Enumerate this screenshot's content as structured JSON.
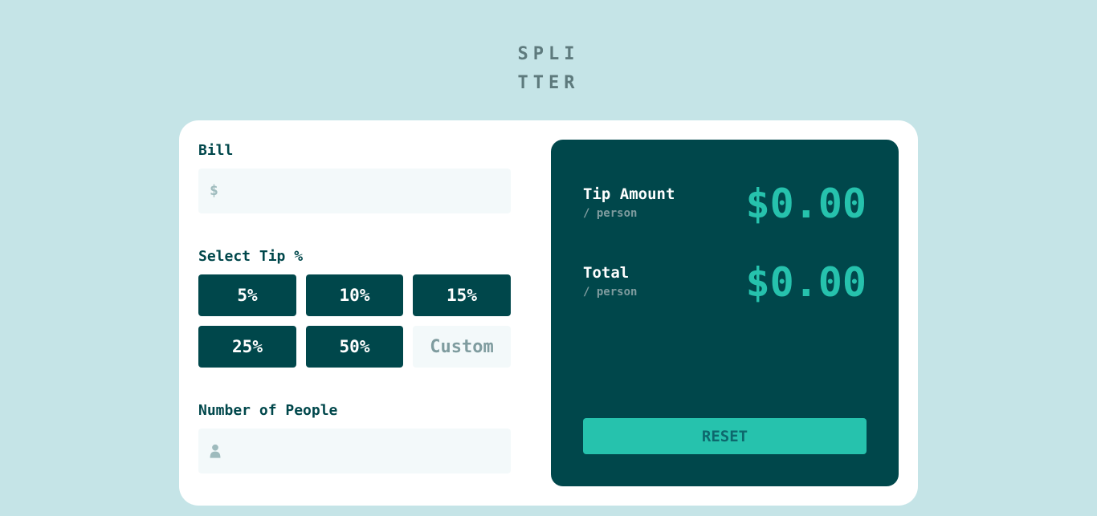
{
  "header": {
    "logo_line1": "SPLI",
    "logo_line2": "TTER"
  },
  "form": {
    "bill": {
      "label": "Bill",
      "prefix": "$",
      "value": ""
    },
    "tip": {
      "label": "Select Tip %",
      "options": [
        "5%",
        "10%",
        "15%",
        "25%",
        "50%"
      ],
      "custom_placeholder": "Custom"
    },
    "people": {
      "label": "Number of People",
      "icon": "person-icon",
      "value": ""
    }
  },
  "results": {
    "tip_amount": {
      "label": "Tip Amount",
      "sub": "/ person",
      "value": "$0.00"
    },
    "total": {
      "label": "Total",
      "sub": "/ person",
      "value": "$0.00"
    },
    "reset_label": "RESET"
  },
  "colors": {
    "background": "#c5e4e7",
    "dark_cyan": "#00474b",
    "strong_cyan": "#26c2ad",
    "grayish_cyan": "#7f9c9f",
    "light_cyan": "#f3f9fa"
  }
}
